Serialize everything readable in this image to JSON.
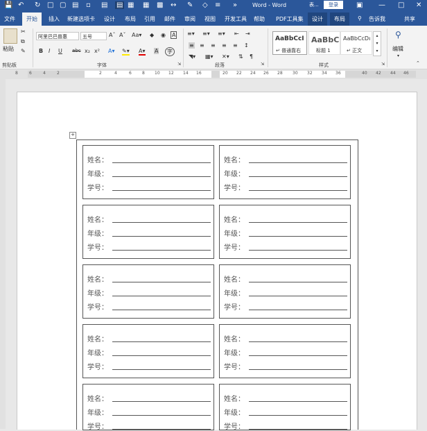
{
  "titlebar": {
    "title": "Word - Word",
    "ime_label": "表...",
    "login_label": "登录"
  },
  "tabs": {
    "file": "文件",
    "home": "开始",
    "insert": "插入",
    "new_tab": "新建选项卡",
    "design": "设计",
    "layout": "布局",
    "references": "引用",
    "mailings": "邮件",
    "review": "审阅",
    "view": "视图",
    "developer": "开发工具",
    "help": "帮助",
    "pdf": "PDF工具集",
    "table_design": "设计",
    "table_layout": "布局",
    "tell_me": "告诉我",
    "share": "共享"
  },
  "ribbon": {
    "paste_label": "粘贴",
    "font_name": "阿里巴巴普惠",
    "font_size": "五号",
    "style1_sample": "AaBbCcI",
    "style1_name": "↵ 普通靠右",
    "style2_sample": "AaBbC",
    "style2_name": "标题 1",
    "style3_sample": "AaBbCcDı",
    "style3_name": "↵ 正文",
    "edit_label": "编辑",
    "group_clipboard": "剪贴板",
    "group_font": "字体",
    "group_paragraph": "段落",
    "group_styles": "样式"
  },
  "ruler": {
    "left_ticks": [
      "8",
      "6",
      "4",
      "2"
    ],
    "ticks": [
      "2",
      "4",
      "6",
      "8",
      "10",
      "12",
      "14",
      "16",
      "20",
      "22",
      "24",
      "26",
      "28",
      "30",
      "32",
      "34",
      "36",
      "40",
      "42",
      "44",
      "46"
    ]
  },
  "cards": {
    "name_label": "姓名：",
    "grade_label": "年级：",
    "id_label": "学号："
  }
}
